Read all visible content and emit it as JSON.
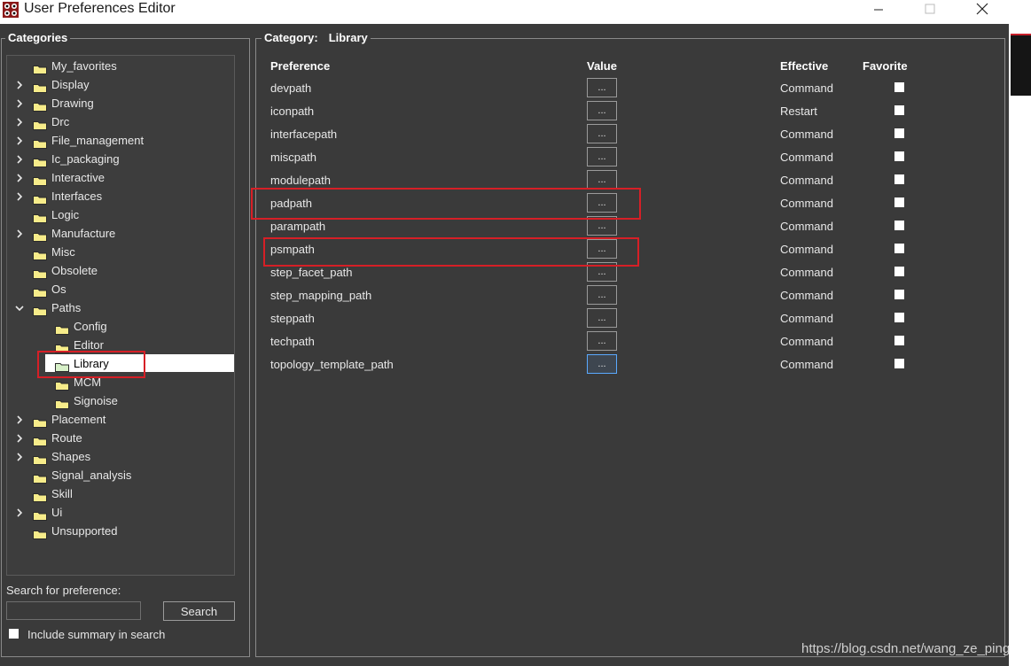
{
  "window": {
    "title": "User Preferences Editor",
    "buttons": [
      "minimize",
      "maximize",
      "close"
    ]
  },
  "categories": {
    "title": "Categories",
    "items": [
      {
        "label": "My_favorites",
        "expandable": false,
        "expanded": false,
        "level": 0
      },
      {
        "label": "Display",
        "expandable": true,
        "expanded": false,
        "level": 0
      },
      {
        "label": "Drawing",
        "expandable": true,
        "expanded": false,
        "level": 0
      },
      {
        "label": "Drc",
        "expandable": true,
        "expanded": false,
        "level": 0
      },
      {
        "label": "File_management",
        "expandable": true,
        "expanded": false,
        "level": 0
      },
      {
        "label": "Ic_packaging",
        "expandable": true,
        "expanded": false,
        "level": 0
      },
      {
        "label": "Interactive",
        "expandable": true,
        "expanded": false,
        "level": 0
      },
      {
        "label": "Interfaces",
        "expandable": true,
        "expanded": false,
        "level": 0
      },
      {
        "label": "Logic",
        "expandable": false,
        "expanded": false,
        "level": 0
      },
      {
        "label": "Manufacture",
        "expandable": true,
        "expanded": false,
        "level": 0
      },
      {
        "label": "Misc",
        "expandable": false,
        "expanded": false,
        "level": 0
      },
      {
        "label": "Obsolete",
        "expandable": false,
        "expanded": false,
        "level": 0
      },
      {
        "label": "Os",
        "expandable": false,
        "expanded": false,
        "level": 0
      },
      {
        "label": "Paths",
        "expandable": true,
        "expanded": true,
        "level": 0
      },
      {
        "label": "Config",
        "expandable": false,
        "expanded": false,
        "level": 1
      },
      {
        "label": "Editor",
        "expandable": false,
        "expanded": false,
        "level": 1
      },
      {
        "label": "Library",
        "expandable": false,
        "expanded": false,
        "level": 1,
        "selected": true
      },
      {
        "label": "MCM",
        "expandable": false,
        "expanded": false,
        "level": 1
      },
      {
        "label": "Signoise",
        "expandable": false,
        "expanded": false,
        "level": 1
      },
      {
        "label": "Placement",
        "expandable": true,
        "expanded": false,
        "level": 0
      },
      {
        "label": "Route",
        "expandable": true,
        "expanded": false,
        "level": 0
      },
      {
        "label": "Shapes",
        "expandable": true,
        "expanded": false,
        "level": 0
      },
      {
        "label": "Signal_analysis",
        "expandable": false,
        "expanded": false,
        "level": 0
      },
      {
        "label": "Skill",
        "expandable": false,
        "expanded": false,
        "level": 0
      },
      {
        "label": "Ui",
        "expandable": true,
        "expanded": false,
        "level": 0
      },
      {
        "label": "Unsupported",
        "expandable": false,
        "expanded": false,
        "level": 0
      }
    ]
  },
  "search": {
    "label": "Search for preference:",
    "value": "",
    "button": "Search",
    "include_summary_label": "Include summary in search",
    "include_summary_checked": false
  },
  "category_panel": {
    "title_label": "Category:",
    "title_value": "Library",
    "columns": [
      "Preference",
      "Value",
      "Effective",
      "Favorite"
    ],
    "value_button_label": "...",
    "rows": [
      {
        "preference": "devpath",
        "effective": "Command",
        "favorite": false
      },
      {
        "preference": "iconpath",
        "effective": "Restart",
        "favorite": false
      },
      {
        "preference": "interfacepath",
        "effective": "Command",
        "favorite": false
      },
      {
        "preference": "miscpath",
        "effective": "Command",
        "favorite": false
      },
      {
        "preference": "modulepath",
        "effective": "Command",
        "favorite": false
      },
      {
        "preference": "padpath",
        "effective": "Command",
        "favorite": false,
        "highlighted": true
      },
      {
        "preference": "parampath",
        "effective": "Command",
        "favorite": false
      },
      {
        "preference": "psmpath",
        "effective": "Command",
        "favorite": false,
        "highlighted": true
      },
      {
        "preference": "step_facet_path",
        "effective": "Command",
        "favorite": false
      },
      {
        "preference": "step_mapping_path",
        "effective": "Command",
        "favorite": false
      },
      {
        "preference": "steppath",
        "effective": "Command",
        "favorite": false
      },
      {
        "preference": "techpath",
        "effective": "Command",
        "favorite": false
      },
      {
        "preference": "topology_template_path",
        "effective": "Command",
        "favorite": false,
        "focused": true
      }
    ]
  },
  "watermark": "https://blog.csdn.net/wang_ze_ping",
  "colors": {
    "background": "#3a3a3a",
    "highlight_box": "#d61f26",
    "selection": "#ffffff",
    "focus": "#5aa9ff"
  }
}
